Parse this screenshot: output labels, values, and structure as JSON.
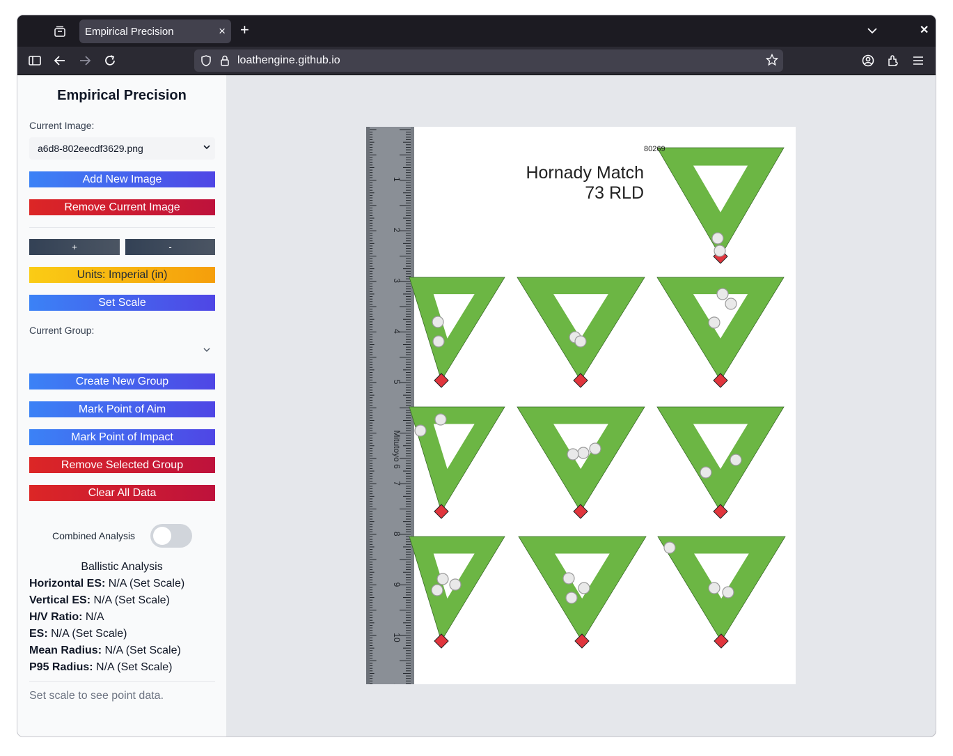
{
  "browser": {
    "tab_title": "Empirical Precision",
    "tab_close": "×",
    "new_tab": "+",
    "window_close": "✕",
    "url": "loathengine.github.io"
  },
  "sidebar": {
    "title": "Empirical Precision",
    "current_image_label": "Current Image:",
    "current_image_value": "a6d8-802eecdf3629.png",
    "add_image": "Add New Image",
    "remove_image": "Remove Current Image",
    "zoom_in": "+",
    "zoom_out": "-",
    "units": "Units: Imperial (in)",
    "set_scale": "Set Scale",
    "current_group_label": "Current Group:",
    "current_group_value": "",
    "create_group": "Create New Group",
    "mark_aim": "Mark Point of Aim",
    "mark_impact": "Mark Point of Impact",
    "remove_group": "Remove Selected Group",
    "clear_all": "Clear All Data",
    "combined_label": "Combined Analysis",
    "combined_on": false,
    "analysis_title": "Ballistic Analysis",
    "stats": [
      {
        "label": "Horizontal ES:",
        "value": " N/A (Set Scale)"
      },
      {
        "label": "Vertical ES:",
        "value": " N/A (Set Scale)"
      },
      {
        "label": "H/V Ratio:",
        "value": " N/A"
      },
      {
        "label": "ES:",
        "value": " N/A (Set Scale)"
      },
      {
        "label": "Mean Radius:",
        "value": " N/A (Set Scale)"
      },
      {
        "label": "P95 Radius:",
        "value": " N/A (Set Scale)"
      }
    ],
    "hint": "Set scale to see point data."
  },
  "target": {
    "code": "80269",
    "title_line1": "Hornady Match",
    "title_line2": "73 RLD",
    "ruler_numbers": [
      "1",
      "2",
      "3",
      "4",
      "5",
      "Mitutoyo 6",
      "7",
      "8",
      "9",
      "10",
      "1"
    ],
    "colors": {
      "green": "#6cb644",
      "red": "#e0353d"
    }
  }
}
